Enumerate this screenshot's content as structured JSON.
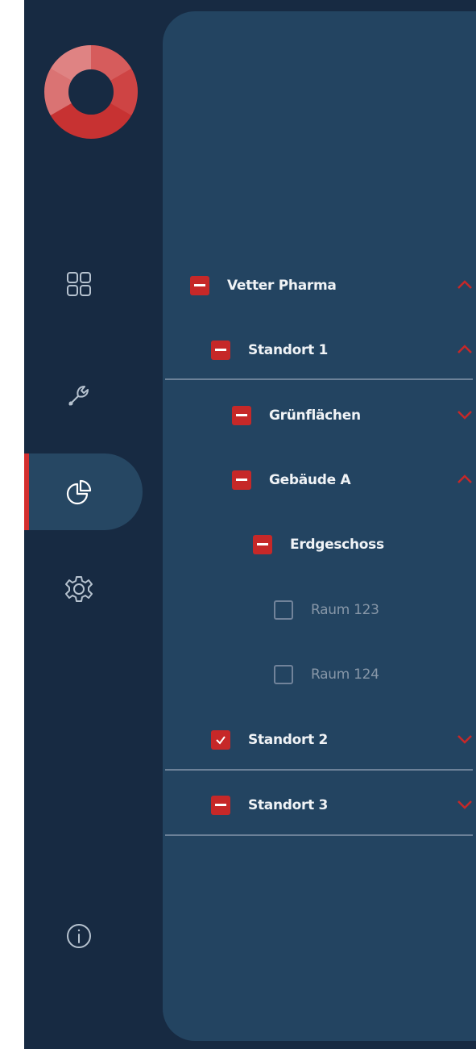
{
  "sidebar": {
    "nav": [
      {
        "key": "dashboard",
        "icon": "grid-icon"
      },
      {
        "key": "tools",
        "icon": "wrench-icon"
      },
      {
        "key": "analytics",
        "icon": "pie-chart-icon",
        "active": true
      },
      {
        "key": "settings",
        "icon": "gear-icon"
      }
    ],
    "footer_icon": "info-icon"
  },
  "tree": {
    "items": [
      {
        "label": "Vetter Pharma",
        "state": "partial",
        "expanded": true
      },
      {
        "label": "Standort 1",
        "state": "partial",
        "expanded": true
      },
      {
        "label": "Grünflächen",
        "state": "partial",
        "expanded": false
      },
      {
        "label": "Gebäude A",
        "state": "partial",
        "expanded": true
      },
      {
        "label": "Erdgeschoss",
        "state": "partial"
      },
      {
        "label": "Raum 123",
        "state": "unchecked"
      },
      {
        "label": "Raum 124",
        "state": "unchecked"
      },
      {
        "label": "Standort 2",
        "state": "checked",
        "expanded": false
      },
      {
        "label": "Standort 3",
        "state": "partial",
        "expanded": false
      }
    ]
  },
  "colors": {
    "sidebar_bg": "#172a42",
    "panel_bg": "#234461",
    "accent": "#c62828",
    "text": "#f0f3f6",
    "muted_text": "#8797a8"
  }
}
